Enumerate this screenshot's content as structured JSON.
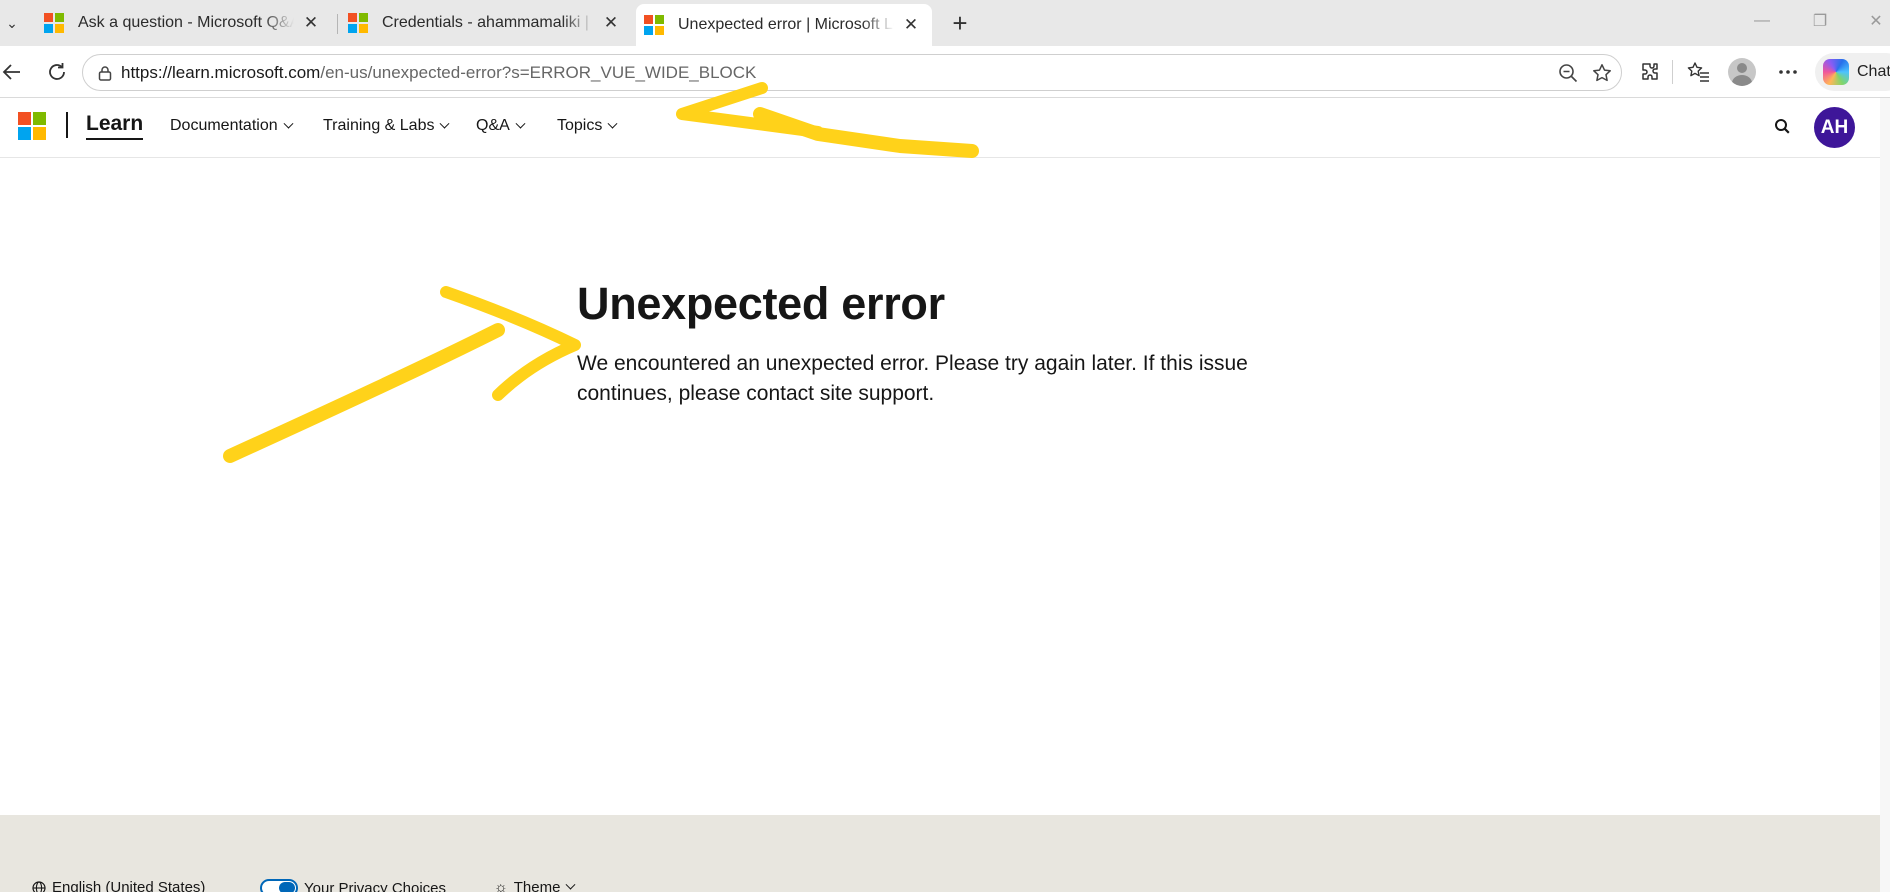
{
  "browser": {
    "tabs": [
      {
        "title": "Ask a question - Microsoft Q&A",
        "active": false
      },
      {
        "title": "Credentials - ahammamaliki | Microsoft",
        "active": false
      },
      {
        "title": "Unexpected error | Microsoft Learn",
        "active": true
      }
    ],
    "address": {
      "host": "https://learn.microsoft.com",
      "path": "/en-us/unexpected-error?s=ERROR_VUE_WIDE_BLOCK"
    },
    "copilot_label": "Chat"
  },
  "site": {
    "brand": "Learn",
    "nav": [
      {
        "label": "Documentation"
      },
      {
        "label": "Training & Labs"
      },
      {
        "label": "Q&A"
      },
      {
        "label": "Topics"
      }
    ],
    "user_initials": "AH"
  },
  "main": {
    "title": "Unexpected error",
    "message": "We encountered an unexpected error. Please try again later. If this issue continues, please contact site support."
  },
  "footer": {
    "language": "English (United States)",
    "privacy": "Your Privacy Choices",
    "theme": "Theme"
  },
  "colors": {
    "accent": "#0067b8",
    "avatar": "#3e1699",
    "annotation": "#ffd21a",
    "footer_bg": "#e8e6df"
  }
}
